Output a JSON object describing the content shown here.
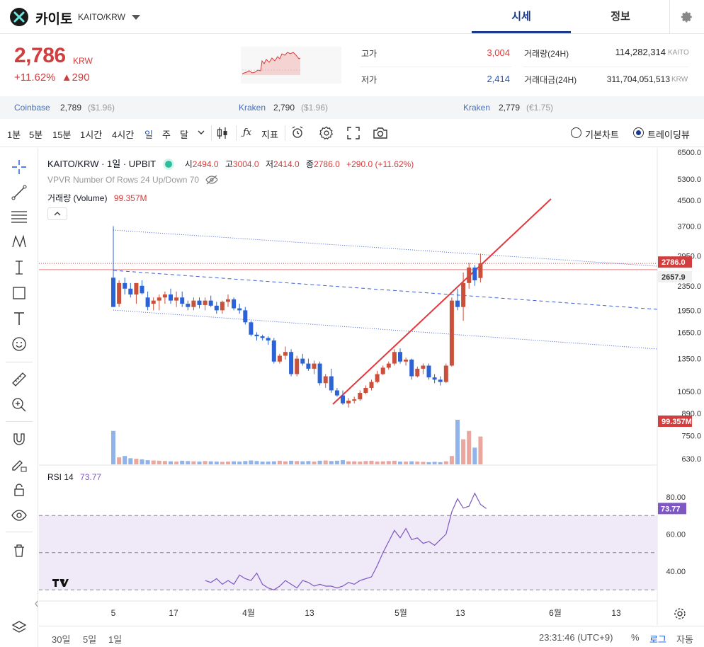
{
  "header": {
    "coin_name": "카이토",
    "pair": "KAITO/KRW",
    "tabs": [
      {
        "label": "시세",
        "active": true
      },
      {
        "label": "정보",
        "active": false
      }
    ]
  },
  "ticker": {
    "price": "2,786",
    "currency": "KRW",
    "change_pct": "+11.62%",
    "change_abs": "▲290",
    "high_label": "고가",
    "high_value": "3,004",
    "low_label": "저가",
    "low_value": "2,414",
    "vol_label": "거래량(24H)",
    "vol_value": "114,282,314",
    "vol_unit": "KAITO",
    "amt_label": "거래대금(24H)",
    "amt_value": "311,704,051,513",
    "amt_unit": "KRW"
  },
  "exchanges": [
    {
      "name": "Coinbase",
      "price": "2,789",
      "usd": "($1.96)"
    },
    {
      "name": "Kraken",
      "price": "2,790",
      "usd": "($1.96)"
    },
    {
      "name": "Kraken",
      "price": "2,779",
      "usd": "(€1.75)"
    }
  ],
  "toolbar": {
    "intervals": [
      "1분",
      "5분",
      "15분",
      "1시간",
      "4시간",
      "일",
      "주",
      "달"
    ],
    "active_interval": "일",
    "indicator_label": "지표",
    "basic_chart": "기본차트",
    "tradingview": "트레이딩뷰"
  },
  "legend": {
    "symbol": "KAITO/KRW · 1일 · UPBIT",
    "o_label": "시",
    "o": "2494.0",
    "h_label": "고",
    "h": "3004.0",
    "l_label": "저",
    "l": "2414.0",
    "c_label": "종",
    "c": "2786.0",
    "chg": "+290.0 (+11.62%)",
    "vpvr": "VPVR Number Of Rows 24 Up/Down 70",
    "volume_label": "거래량 (Volume)",
    "volume_value": "99.357M",
    "rsi_label": "RSI 14",
    "rsi_value": "73.77"
  },
  "chart_data": {
    "type": "candlestick",
    "price_axis_ticks": [
      "6500.0",
      "5300.0",
      "4500.0",
      "3700.0",
      "2950.0",
      "2350.0",
      "1950.0",
      "1650.0",
      "1350.0",
      "1050.0",
      "890.0",
      "750.0",
      "630.0"
    ],
    "price_axis_scale": "log",
    "last_price_tag": "2786.0",
    "prev_close_tag": "2657.9",
    "volume_tag": "99.357M",
    "rsi_axis_ticks": [
      "80.00",
      "60.00",
      "40.00"
    ],
    "rsi_tag": "73.77",
    "x_ticks": [
      "5",
      "17",
      "4월",
      "13",
      "5월",
      "13",
      "6월",
      "13"
    ],
    "candles": [
      [
        2500,
        3700,
        2000,
        2000
      ],
      [
        2050,
        2450,
        2000,
        2400
      ],
      [
        2400,
        2500,
        2200,
        2300
      ],
      [
        2300,
        2400,
        2150,
        2200
      ],
      [
        2200,
        2400,
        2050,
        2400
      ],
      [
        2350,
        2450,
        2200,
        2220
      ],
      [
        2150,
        2250,
        1950,
        2000
      ],
      [
        2050,
        2150,
        1950,
        2100
      ],
      [
        2100,
        2200,
        1950,
        2150
      ],
      [
        2150,
        2250,
        2050,
        2200
      ],
      [
        2200,
        2300,
        2050,
        2100
      ],
      [
        2100,
        2250,
        2000,
        2150
      ],
      [
        2150,
        2250,
        2000,
        2050
      ],
      [
        2050,
        2100,
        1950,
        2000
      ],
      [
        2000,
        2150,
        1950,
        2100
      ],
      [
        2100,
        2150,
        1980,
        2030
      ],
      [
        2030,
        2150,
        1950,
        2100
      ],
      [
        2100,
        2180,
        2000,
        2020
      ],
      [
        2020,
        2080,
        1900,
        1950
      ],
      [
        1950,
        2100,
        1900,
        2080
      ],
      [
        2080,
        2200,
        2000,
        2120
      ],
      [
        2120,
        2150,
        1950,
        1980
      ],
      [
        1980,
        2050,
        1900,
        1950
      ],
      [
        1950,
        2000,
        1750,
        1780
      ],
      [
        1780,
        1800,
        1600,
        1620
      ],
      [
        1620,
        1650,
        1550,
        1600
      ],
      [
        1600,
        1620,
        1550,
        1580
      ],
      [
        1580,
        1600,
        1500,
        1550
      ],
      [
        1550,
        1580,
        1300,
        1320
      ],
      [
        1320,
        1400,
        1300,
        1380
      ],
      [
        1380,
        1480,
        1340,
        1420
      ],
      [
        1420,
        1450,
        1180,
        1200
      ],
      [
        1200,
        1380,
        1180,
        1350
      ],
      [
        1350,
        1400,
        1280,
        1300
      ],
      [
        1300,
        1350,
        1230,
        1250
      ],
      [
        1250,
        1330,
        1200,
        1300
      ],
      [
        1300,
        1320,
        1100,
        1120
      ],
      [
        1120,
        1200,
        1080,
        1180
      ],
      [
        1180,
        1250,
        1040,
        1060
      ],
      [
        1060,
        1080,
        1010,
        1020
      ],
      [
        1020,
        1060,
        950,
        960
      ],
      [
        960,
        1000,
        930,
        980
      ],
      [
        980,
        1010,
        960,
        990
      ],
      [
        990,
        1060,
        980,
        1040
      ],
      [
        1040,
        1100,
        1030,
        1080
      ],
      [
        1080,
        1150,
        1060,
        1130
      ],
      [
        1130,
        1230,
        1120,
        1200
      ],
      [
        1200,
        1280,
        1190,
        1260
      ],
      [
        1260,
        1320,
        1240,
        1300
      ],
      [
        1300,
        1450,
        1280,
        1420
      ],
      [
        1420,
        1460,
        1300,
        1320
      ],
      [
        1320,
        1360,
        1280,
        1340
      ],
      [
        1340,
        1350,
        1150,
        1180
      ],
      [
        1180,
        1270,
        1170,
        1250
      ],
      [
        1250,
        1300,
        1200,
        1280
      ],
      [
        1280,
        1300,
        1150,
        1170
      ],
      [
        1170,
        1200,
        1120,
        1150
      ],
      [
        1150,
        1180,
        1100,
        1130
      ],
      [
        1130,
        1300,
        1120,
        1280
      ],
      [
        1280,
        2150,
        1270,
        2100
      ],
      [
        2100,
        2300,
        1950,
        2000
      ],
      [
        2000,
        2600,
        1800,
        2400
      ],
      [
        2400,
        2800,
        2300,
        2700
      ],
      [
        2700,
        2750,
        2350,
        2450
      ],
      [
        2494,
        3004,
        2414,
        2786
      ]
    ],
    "volumes": [
      12,
      2.5,
      3,
      2.2,
      2,
      1.8,
      1.5,
      1.4,
      1.3,
      1.2,
      1.1,
      1,
      1.3,
      1.2,
      1.1,
      1,
      1.2,
      1.1,
      1,
      0.9,
      1,
      1.1,
      1,
      1.2,
      1.4,
      1.2,
      1,
      1,
      1.1,
      1.3,
      1.1,
      1.3,
      1.2,
      1.1,
      1.2,
      1,
      1.3,
      1.4,
      1.2,
      1.3,
      1.5,
      1.1,
      1.1,
      1,
      1.2,
      1.3,
      1,
      1.1,
      1.2,
      1.3,
      1,
      1,
      1.1,
      1,
      0.9,
      0.8,
      0.9,
      0.8,
      1.1,
      3,
      16,
      9,
      12,
      6,
      10
    ],
    "rsi": [
      null,
      null,
      null,
      null,
      null,
      null,
      null,
      null,
      null,
      null,
      null,
      null,
      null,
      null,
      null,
      null,
      null,
      null,
      null,
      null,
      null,
      null,
      35,
      34,
      36,
      33,
      35,
      33,
      38,
      36,
      35,
      39,
      33,
      31,
      30,
      32,
      35,
      33,
      31,
      35,
      34,
      32,
      33,
      32,
      32,
      31,
      32,
      34,
      33,
      35,
      36,
      37,
      43,
      50,
      56,
      62,
      58,
      63,
      57,
      58,
      55,
      56,
      54,
      57,
      60,
      72,
      79,
      74,
      75,
      82,
      76,
      73.77
    ]
  },
  "timestamp": "23:31:46 (UTC+9)",
  "bottom": {
    "ranges": [
      "30일",
      "5일",
      "1일"
    ],
    "pct": "%",
    "log": "로그",
    "auto": "자동"
  }
}
